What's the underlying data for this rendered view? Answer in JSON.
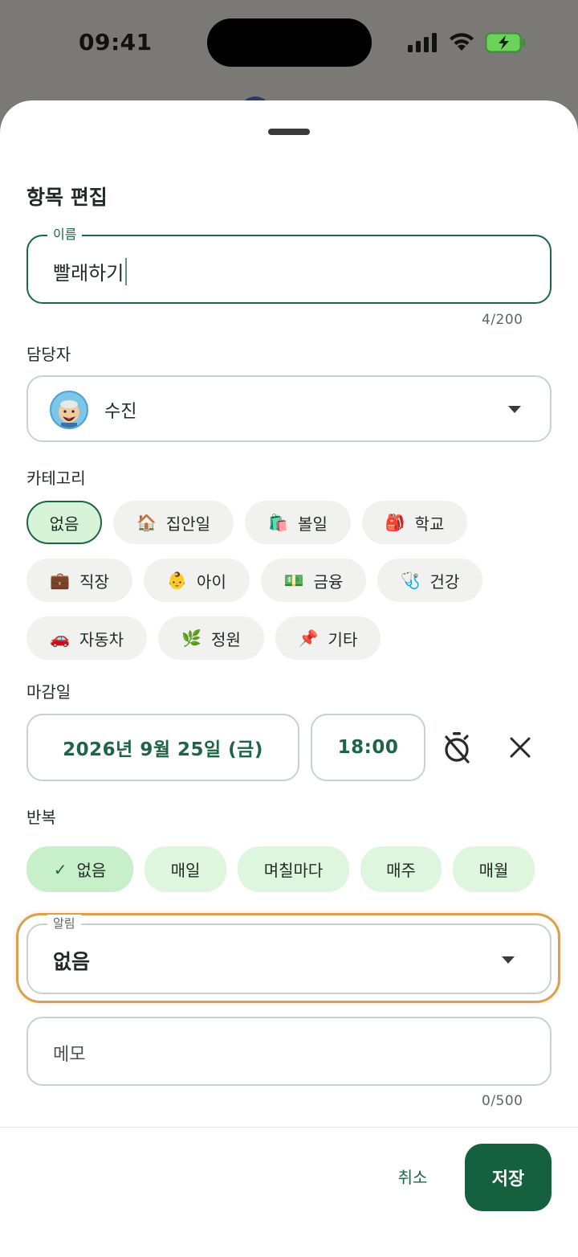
{
  "status_bar": {
    "time": "09:41"
  },
  "sheet": {
    "title": "항목 편집",
    "name_field": {
      "label": "이름",
      "value": "빨래하기",
      "counter": "4/200"
    },
    "assignee": {
      "section_label": "담당자",
      "name": "수진"
    },
    "category": {
      "section_label": "카테고리",
      "chips": [
        {
          "emoji": "",
          "label": "없음",
          "selected": true
        },
        {
          "emoji": "🏠",
          "label": "집안일"
        },
        {
          "emoji": "🛍️",
          "label": "볼일"
        },
        {
          "emoji": "🎒",
          "label": "학교"
        },
        {
          "emoji": "💼",
          "label": "직장"
        },
        {
          "emoji": "👶",
          "label": "아이"
        },
        {
          "emoji": "💵",
          "label": "금융"
        },
        {
          "emoji": "🩺",
          "label": "건강"
        },
        {
          "emoji": "🚗",
          "label": "자동차"
        },
        {
          "emoji": "🌿",
          "label": "정원"
        },
        {
          "emoji": "📌",
          "label": "기타"
        }
      ]
    },
    "due": {
      "section_label": "마감일",
      "date": "2026년 9월 25일 (금)",
      "time": "18:00"
    },
    "repeat": {
      "section_label": "반복",
      "options": [
        {
          "label": "없음",
          "selected": true
        },
        {
          "label": "매일"
        },
        {
          "label": "며칠마다"
        },
        {
          "label": "매주"
        },
        {
          "label": "매월"
        }
      ]
    },
    "alarm": {
      "label": "알림",
      "value": "없음"
    },
    "memo": {
      "placeholder": "메모",
      "counter": "0/500"
    },
    "actions": {
      "cancel": "취소",
      "save": "저장"
    }
  },
  "colors": {
    "accent": "#1e6548",
    "highlight": "#d9a14f",
    "chip_bg": "#f1f2ef",
    "repeat_chip_bg": "#def5de"
  }
}
